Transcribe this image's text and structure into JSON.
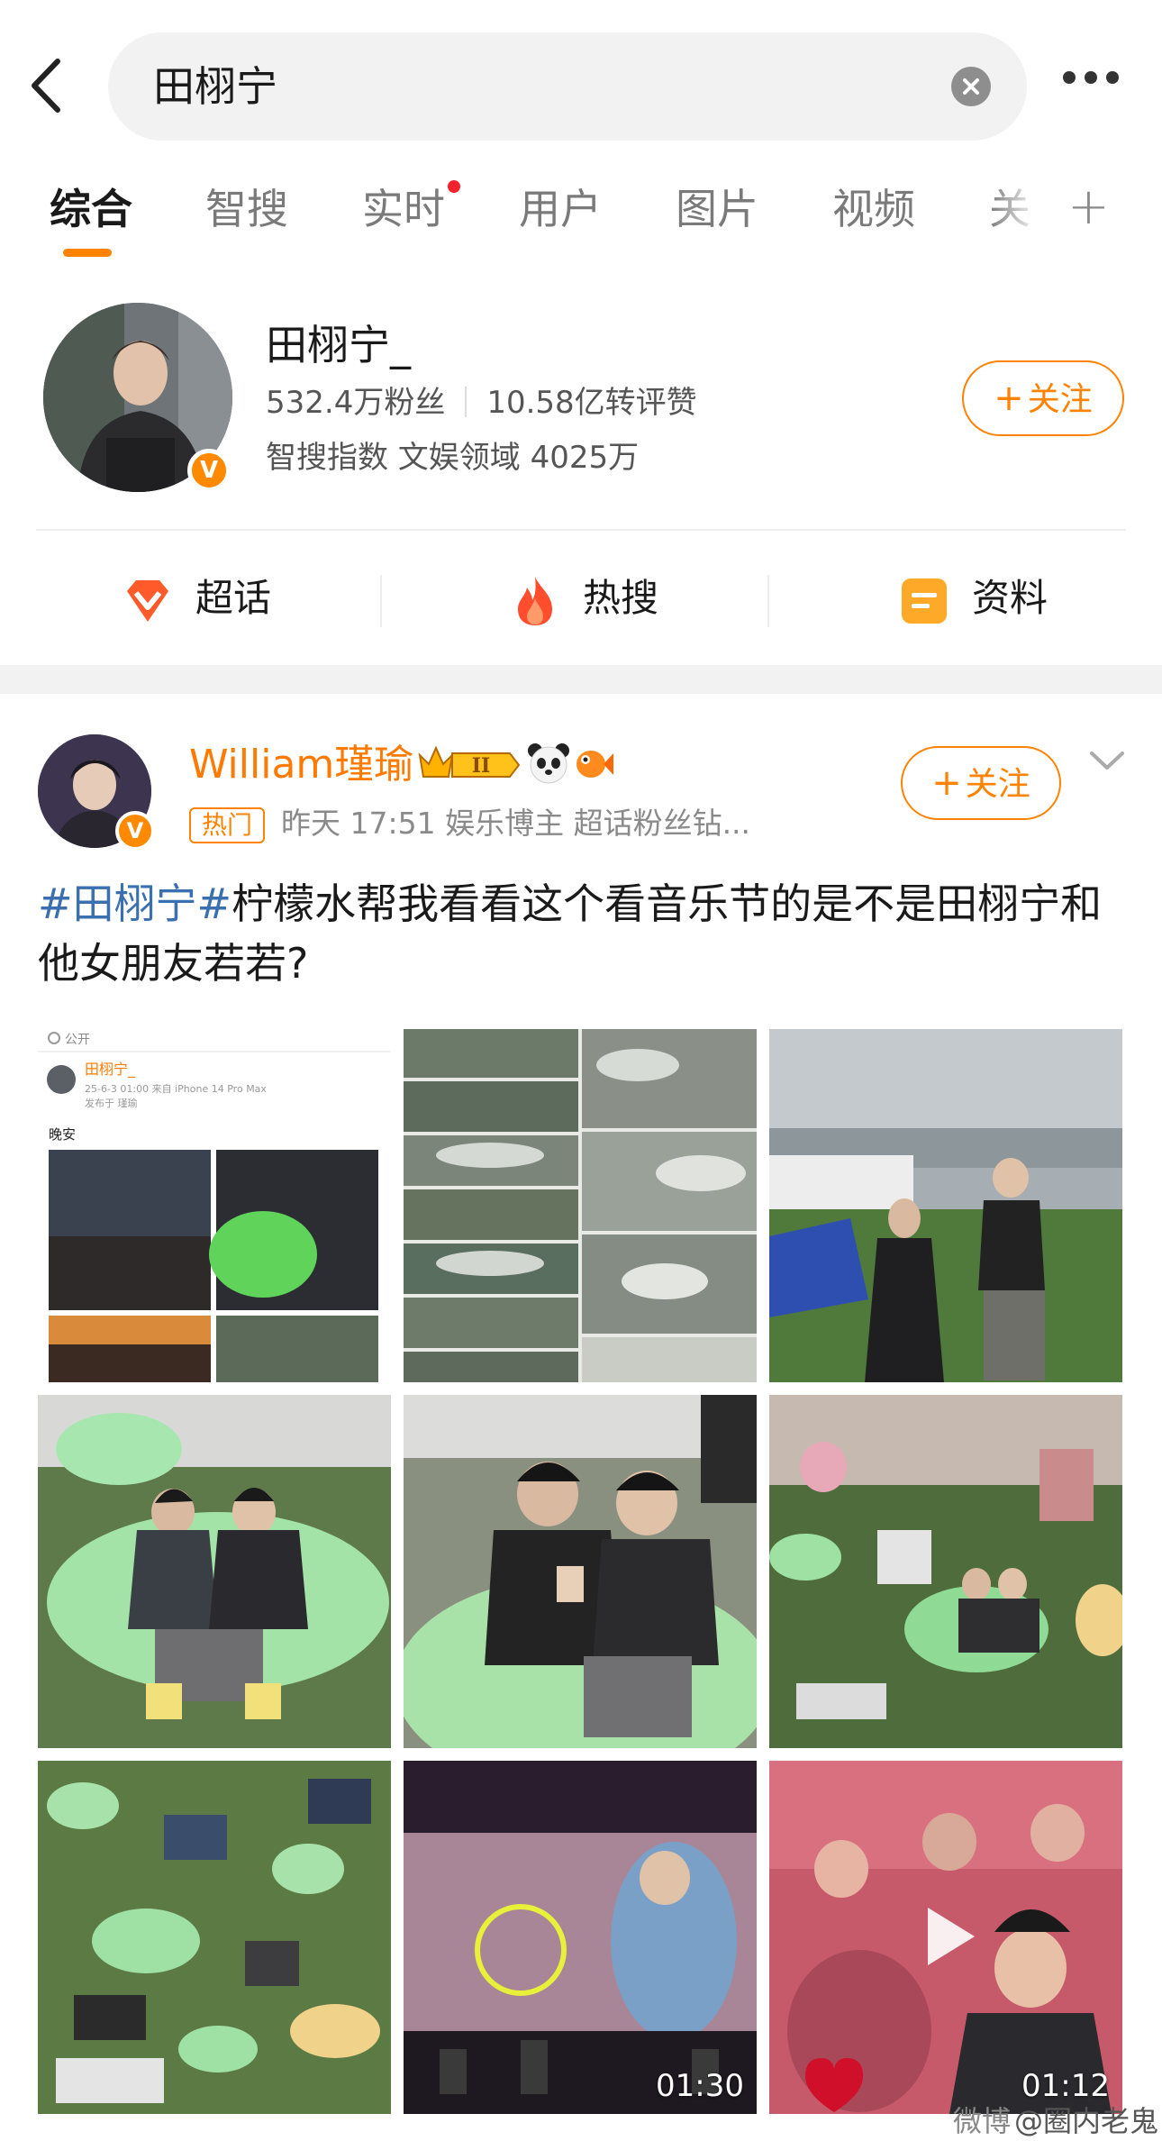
{
  "search": {
    "query": "田栩宁"
  },
  "tabs": [
    {
      "label": "综合",
      "active": true
    },
    {
      "label": "智搜"
    },
    {
      "label": "实时",
      "has_dot": true
    },
    {
      "label": "用户"
    },
    {
      "label": "图片"
    },
    {
      "label": "视频"
    },
    {
      "label": "关"
    }
  ],
  "tabs_plus": "+",
  "profile": {
    "name": "田栩宁_",
    "fans": "532.4万粉丝",
    "interactions": "10.58亿转评赞",
    "index": "智搜指数 文娱领域 4025万",
    "follow": {
      "plus": "+",
      "label": "关注"
    }
  },
  "quick_links": [
    {
      "label": "超话",
      "icon": "supertopic-icon"
    },
    {
      "label": "热搜",
      "icon": "flame-icon"
    },
    {
      "label": "资料",
      "icon": "profile-doc-icon"
    }
  ],
  "post": {
    "username": "William瑾瑜",
    "badge_text": "II",
    "hot_tag": "热门",
    "meta": "昨天 17:51  娱乐博主 超话粉丝钻...",
    "hashtag": "#田栩宁#",
    "text": "柠檬水帮我看看这个看音乐节的是不是田栩宁和他女朋友若若?",
    "follow": {
      "plus": "+",
      "label": "关注"
    },
    "images": [
      {
        "type": "screenshot"
      },
      {
        "type": "crowd-collage"
      },
      {
        "type": "couple-walking"
      },
      {
        "type": "couple-beanbag"
      },
      {
        "type": "couple-closeup"
      },
      {
        "type": "crowd-lawn"
      },
      {
        "type": "lawn-aerial"
      },
      {
        "type": "concert-video",
        "duration": "01:30"
      },
      {
        "type": "crowd-video",
        "duration": "01:12"
      }
    ],
    "screenshot": {
      "public_label": "公开",
      "name": "田栩宁_",
      "date": "25-6-3 01:00  来自 iPhone 14 Pro Max",
      "sub": "发布于 瑾瑜",
      "text": "晚安"
    }
  },
  "watermark": {
    "logo": "微博",
    "text": "@圈内老鬼"
  },
  "colors": {
    "accent": "#ff8200",
    "hashtag": "#3a6fb0",
    "username": "#ff7a00"
  }
}
